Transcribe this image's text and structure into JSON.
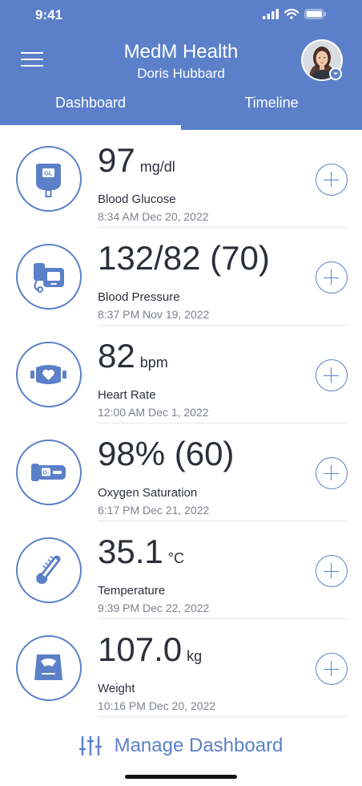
{
  "status_bar": {
    "time": "9:41"
  },
  "header": {
    "app_title": "MedM Health",
    "user_name": "Doris Hubbard",
    "tabs": [
      {
        "label": "Dashboard",
        "active": true
      },
      {
        "label": "Timeline",
        "active": false
      }
    ]
  },
  "colors": {
    "accent": "#5b80c9",
    "text": "#2b2f38",
    "muted": "#7c818a"
  },
  "metrics": [
    {
      "value": "97",
      "unit": "mg/dl",
      "label": "Blood Glucose",
      "timestamp": "8:34 AM Dec 20, 2022",
      "icon": "glucometer-icon"
    },
    {
      "value": "132/82 (70)",
      "unit": "",
      "label": "Blood Pressure",
      "timestamp": "8:37 PM Nov 19, 2022",
      "icon": "blood-pressure-monitor-icon"
    },
    {
      "value": "82",
      "unit": "bpm",
      "label": "Heart Rate",
      "timestamp": "12:00 AM Dec 1, 2022",
      "icon": "heart-rate-strap-icon"
    },
    {
      "value": "98% (60)",
      "unit": "",
      "label": "Oxygen Saturation",
      "timestamp": "6:17 PM Dec 21, 2022",
      "icon": "pulse-oximeter-icon"
    },
    {
      "value": "35.1",
      "unit": "°C",
      "label": "Temperature",
      "timestamp": "9:39 PM Dec 22, 2022",
      "icon": "thermometer-icon"
    },
    {
      "value": "107.0",
      "unit": "kg",
      "label": "Weight",
      "timestamp": "10:16 PM Dec 20, 2022",
      "icon": "scale-icon"
    }
  ],
  "footer": {
    "manage_label": "Manage Dashboard"
  }
}
